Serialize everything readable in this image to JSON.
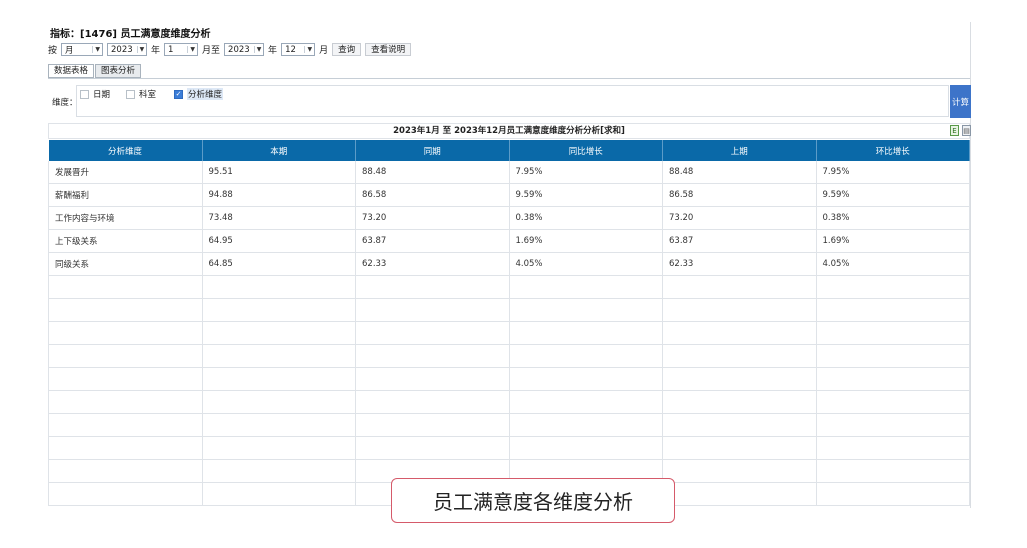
{
  "title": "指标：[1476] 员工满意度维度分析",
  "controls": {
    "prefix": "按",
    "period": "月",
    "start_year": "2023",
    "year_label": "年",
    "start_month": "1",
    "month_to_label": "月至",
    "end_year": "2023",
    "end_month": "12",
    "month_label": "月",
    "query_label": "查询",
    "info_label": "查看说明"
  },
  "tabs": [
    "数据表格",
    "图表分析"
  ],
  "dimension": {
    "label": "维度：",
    "options": [
      {
        "label": "日期",
        "checked": false
      },
      {
        "label": "科室",
        "checked": false
      },
      {
        "label": "分析维度",
        "checked": true
      }
    ],
    "calc_label": "计算"
  },
  "table": {
    "caption": "2023年1月 至 2023年12月员工满意度维度分析分析[求和]",
    "headers": [
      "分析维度",
      "本期",
      "同期",
      "同比增长",
      "上期",
      "环比增长"
    ],
    "rows": [
      [
        "发展晋升",
        "95.51",
        "88.48",
        "7.95%",
        "88.48",
        "7.95%"
      ],
      [
        "薪酬福利",
        "94.88",
        "86.58",
        "9.59%",
        "86.58",
        "9.59%"
      ],
      [
        "工作内容与环境",
        "73.48",
        "73.20",
        "0.38%",
        "73.20",
        "0.38%"
      ],
      [
        "上下级关系",
        "64.95",
        "63.87",
        "1.69%",
        "63.87",
        "1.69%"
      ],
      [
        "同级关系",
        "64.85",
        "62.33",
        "4.05%",
        "62.33",
        "4.05%"
      ]
    ]
  },
  "banner": "员工满意度各维度分析"
}
